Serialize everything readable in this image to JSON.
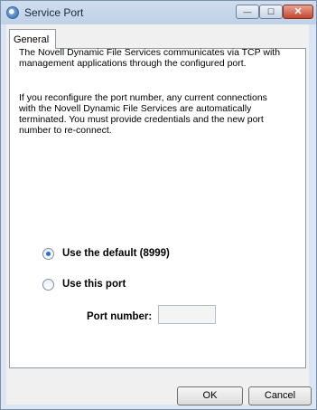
{
  "window": {
    "title": "Service Port",
    "controls": {
      "minimize": "—",
      "maximize": "☐",
      "close": "✕"
    }
  },
  "tabs": [
    {
      "label": "General",
      "selected": true
    }
  ],
  "content": {
    "paragraph1": "The Novell Dynamic File Services communicates via TCP with management applications through the configured port.",
    "paragraph2": "If you reconfigure the port number, any current connections with the Novell Dynamic File Services are automatically terminated. You must provide credentials and the new port number to re-connect.",
    "options": [
      {
        "label": "Use the default (8999)",
        "checked": true
      },
      {
        "label": "Use this port",
        "checked": false
      }
    ],
    "port_label": "Port number:",
    "port_value": ""
  },
  "buttons": {
    "ok": "OK",
    "cancel": "Cancel"
  },
  "icons": {
    "app": "service-port-icon"
  }
}
